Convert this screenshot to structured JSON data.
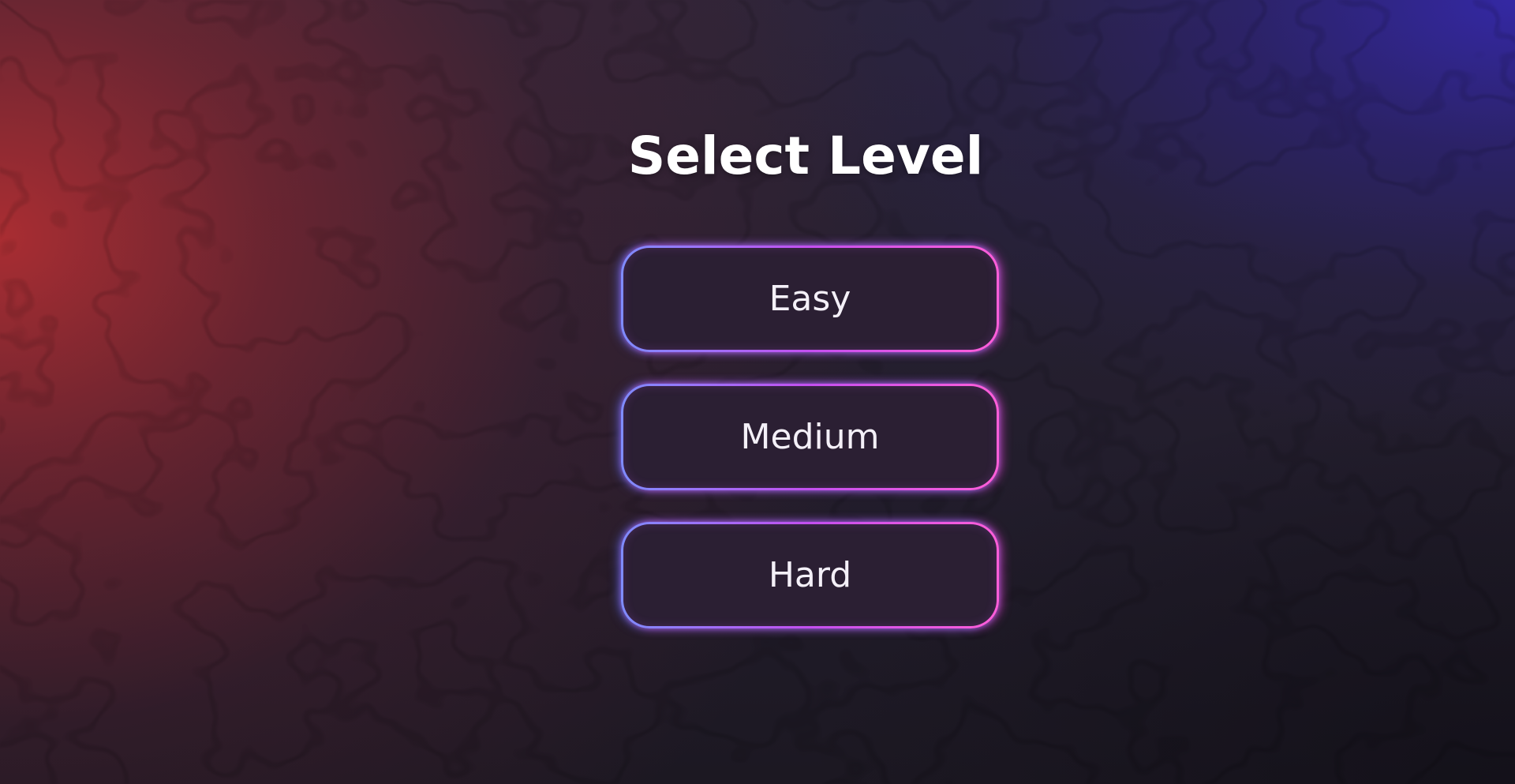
{
  "menu": {
    "title": "Select Level",
    "levels": [
      {
        "id": "easy",
        "label": "Easy"
      },
      {
        "id": "medium",
        "label": "Medium"
      },
      {
        "id": "hard",
        "label": "Hard"
      }
    ]
  },
  "theme": {
    "background_left": "#b02e32",
    "background_top_right": "#3428a6",
    "background_base": "#1c1822",
    "button_fill": "#2b1f33",
    "button_border_start": "#7f8cff",
    "button_border_mid": "#c44ff0",
    "button_border_end": "#ff5ed9",
    "text_color": "#ffffff"
  }
}
